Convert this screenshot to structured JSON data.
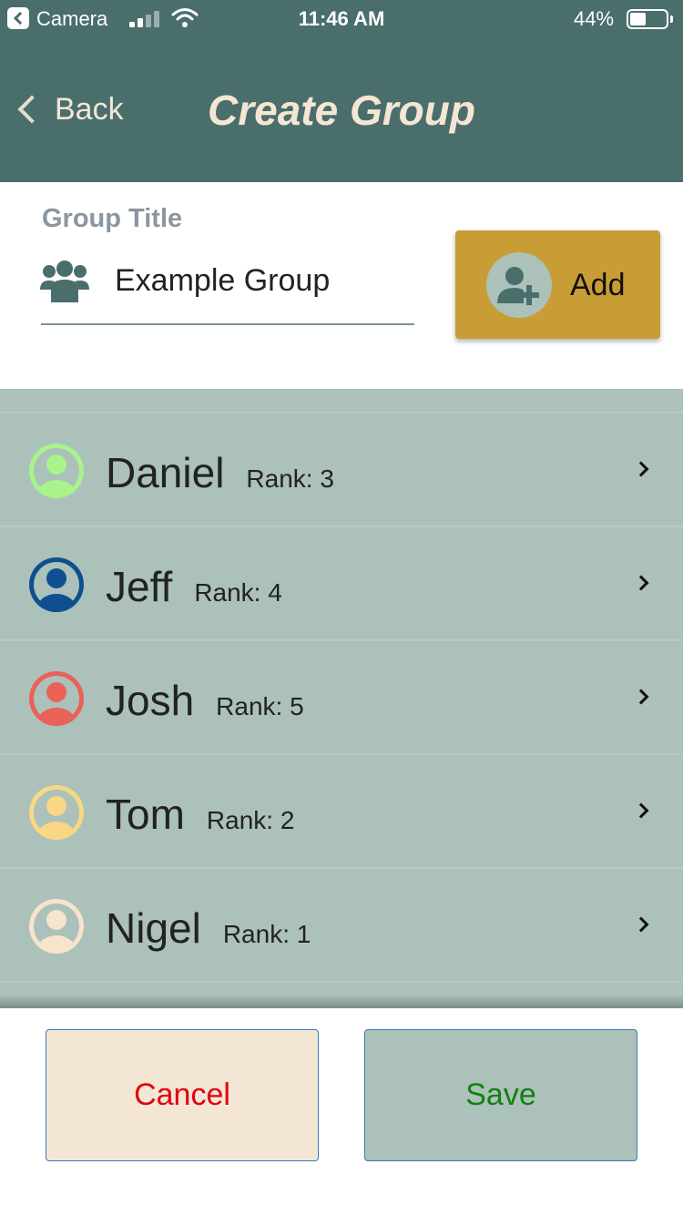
{
  "status_bar": {
    "back_app": "Camera",
    "time": "11:46 AM",
    "battery_percent": "44%",
    "battery_level": 0.44,
    "signal_bars": 2
  },
  "nav": {
    "back_label": "Back",
    "title": "Create Group"
  },
  "form": {
    "label": "Group Title",
    "title_value": "Example Group",
    "add_label": "Add"
  },
  "members": [
    {
      "name": "Daniel",
      "rank": "Rank: 3",
      "avatar_color": "#a6f48a"
    },
    {
      "name": "Jeff",
      "rank": "Rank: 4",
      "avatar_color": "#0f4f8f"
    },
    {
      "name": "Josh",
      "rank": "Rank: 5",
      "avatar_color": "#ea6158"
    },
    {
      "name": "Tom",
      "rank": "Rank: 2",
      "avatar_color": "#f9d784"
    },
    {
      "name": "Nigel",
      "rank": "Rank: 1",
      "avatar_color": "#f6e4cc"
    }
  ],
  "footer": {
    "cancel_label": "Cancel",
    "save_label": "Save"
  },
  "colors": {
    "header": "#4a6e6c",
    "add_button": "#c89d35",
    "list_bg": "#abc1ba",
    "cancel_bg": "#f3e6d5",
    "cancel_text": "#e3000f",
    "save_text": "#128012"
  }
}
